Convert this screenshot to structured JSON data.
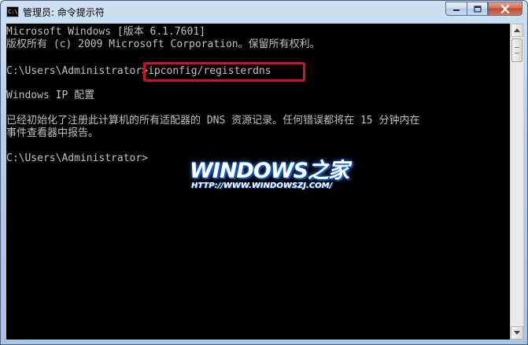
{
  "window": {
    "title": "管理员: 命令提示符",
    "icon": "cmd-icon",
    "icon_glyph": "C:\\"
  },
  "console": {
    "lines": [
      "Microsoft Windows [版本 6.1.7601]",
      "版权所有 (c) 2009 Microsoft Corporation。保留所有权利。",
      "",
      "C:\\Users\\Administrator>ipconfig/registerdns",
      "",
      "Windows IP 配置",
      "",
      "已经初始化了注册此计算机的所有适配器的 DNS 资源记录。任何错误都将在 15 分钟内在",
      "事件查看器中报告。",
      "",
      "C:\\Users\\Administrator>"
    ],
    "highlighted_command": "ipconfig/registerdns",
    "text_color": "#c0c0c0",
    "background": "#000000"
  },
  "watermark": {
    "logo": "WINDOWS之家",
    "url": "HTTP://WWW.WINDOWSZJ.COM/"
  },
  "colors": {
    "highlight_box": "#c8152c",
    "close_button": "#c14a2e",
    "titlebar": "#b6cde8"
  }
}
